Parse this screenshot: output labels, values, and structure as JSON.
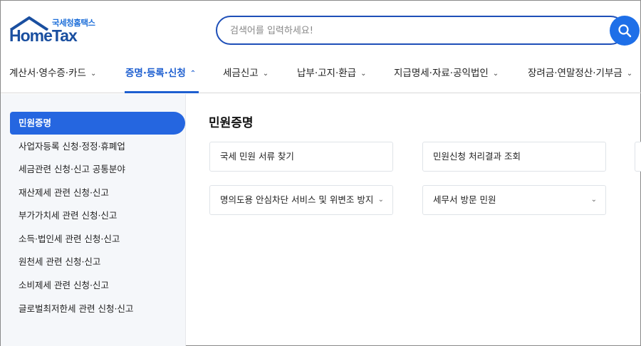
{
  "brand": {
    "subtitle": "국세청홈택스",
    "name": "HomeTax",
    "accent": "#1e6fd9",
    "dark": "#1a4fa0"
  },
  "search": {
    "placeholder": "검색어를 입력하세요!",
    "icon": "search-icon",
    "button_color": "#1e6fe8"
  },
  "nav": {
    "items": [
      {
        "label": "계산서·영수증·카드",
        "icon": "chevron-down-icon"
      },
      {
        "label": "증명·등록·신청",
        "icon": "chevron-up-icon",
        "active": true
      },
      {
        "label": "세금신고",
        "icon": "chevron-down-icon"
      },
      {
        "label": "납부·고지·환급",
        "icon": "chevron-down-icon"
      },
      {
        "label": "지급명세·자료·공익법인",
        "icon": "chevron-down-icon"
      },
      {
        "label": "장려금·연말정산·기부금",
        "icon": "chevron-down-icon"
      }
    ],
    "active_color": "#1e5fd0"
  },
  "sidebar": {
    "items": [
      {
        "label": "민원증명",
        "active": true
      },
      {
        "label": "사업자등록 신청·정정·휴폐업"
      },
      {
        "label": "세금관련 신청·신고 공통분야"
      },
      {
        "label": "재산제세 관련 신청·신고"
      },
      {
        "label": "부가가치세 관련 신청·신고"
      },
      {
        "label": "소득·법인세 관련 신청·신고"
      },
      {
        "label": "원천세 관련 신청·신고"
      },
      {
        "label": "소비제세 관련 신청·신고"
      },
      {
        "label": "글로벌최저한세 관련 신청·신고"
      }
    ],
    "active_color": "#2566e0"
  },
  "main": {
    "title": "민원증명",
    "cards": [
      {
        "label": "국세 민원 서류 찾기"
      },
      {
        "label": "민원신청 처리결과 조회"
      },
      {
        "label": "명의도용 안심차단 서비스 및 위변조 방지",
        "icon": "chevron-down-icon"
      },
      {
        "label": "세무서 방문 민원",
        "icon": "chevron-down-icon"
      }
    ]
  }
}
